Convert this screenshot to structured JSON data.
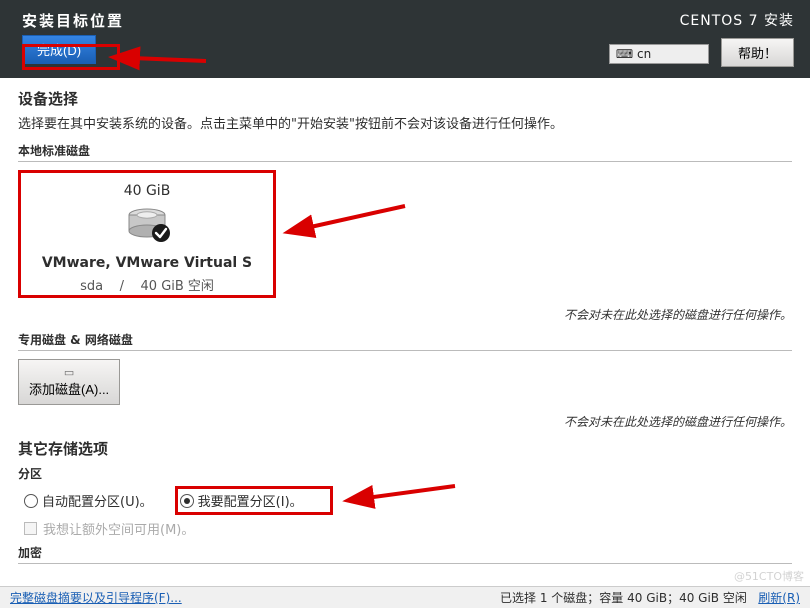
{
  "header": {
    "title": "安装目标位置",
    "done_label": "完成(D)",
    "product_title": "CENTOS 7 安装",
    "lang_indicator": "⌨ cn",
    "help_label": "帮助！"
  },
  "device_selection": {
    "heading": "设备选择",
    "instruction": "选择要在其中安装系统的设备。点击主菜单中的\"开始安装\"按钮前不会对该设备进行任何操作。",
    "local_disks_label": "本地标准磁盘",
    "disk": {
      "size": "40 GiB",
      "name": "VMware, VMware Virtual S",
      "device": "sda",
      "separator": "/",
      "free": "40 GiB 空闲"
    },
    "note": "不会对未在此处选择的磁盘进行任何操作。",
    "special_disks_label": "专用磁盘 & 网络磁盘",
    "add_disk_label": "添加磁盘(A)..."
  },
  "other_storage": {
    "heading": "其它存储选项",
    "partitioning_label": "分区",
    "auto_label": "自动配置分区(U)。",
    "manual_label": "我要配置分区(I)。",
    "reclaim_label": "我想让额外空间可用(M)。",
    "encryption_label": "加密"
  },
  "footer": {
    "summary_link": "完整磁盘摘要以及引导程序(F)...",
    "status": "已选择 1 个磁盘；容量 40 GiB；40 GiB 空闲",
    "refresh_link": "刷新(R)"
  },
  "watermark": "@51CTO博客"
}
